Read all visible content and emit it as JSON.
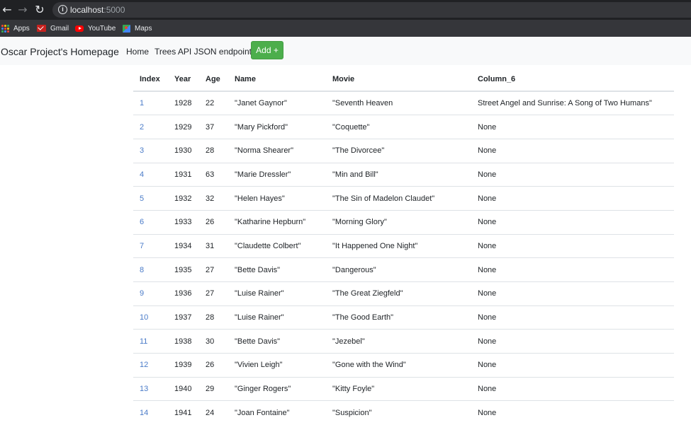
{
  "browser": {
    "url_host": "localhost",
    "url_port": ":5000",
    "bookmarks": [
      {
        "label": "Apps",
        "icon": "apps-grid-icon"
      },
      {
        "label": "Gmail",
        "icon": "gmail-icon"
      },
      {
        "label": "YouTube",
        "icon": "youtube-icon"
      },
      {
        "label": "Maps",
        "icon": "maps-icon"
      }
    ]
  },
  "navbar": {
    "brand": "Oscar Project's Homepage",
    "links": [
      "Home",
      "Trees API JSON endpoint"
    ],
    "add_button": "Add +"
  },
  "colors": {
    "accent_link": "#4a7bc8",
    "add_button": "#4cae4c",
    "navbar_bg": "#f8f9fa"
  },
  "table": {
    "columns": [
      "Index",
      "Year",
      "Age",
      "Name",
      "Movie",
      "Column_6"
    ],
    "rows": [
      [
        "1",
        "1928",
        "22",
        "\"Janet Gaynor\"",
        "\"Seventh Heaven",
        "Street Angel and Sunrise: A Song of Two Humans\""
      ],
      [
        "2",
        "1929",
        "37",
        "\"Mary Pickford\"",
        "\"Coquette\"",
        "None"
      ],
      [
        "3",
        "1930",
        "28",
        "\"Norma Shearer\"",
        "\"The Divorcee\"",
        "None"
      ],
      [
        "4",
        "1931",
        "63",
        "\"Marie Dressler\"",
        "\"Min and Bill\"",
        "None"
      ],
      [
        "5",
        "1932",
        "32",
        "\"Helen Hayes\"",
        "\"The Sin of Madelon Claudet\"",
        "None"
      ],
      [
        "6",
        "1933",
        "26",
        "\"Katharine Hepburn\"",
        "\"Morning Glory\"",
        "None"
      ],
      [
        "7",
        "1934",
        "31",
        "\"Claudette Colbert\"",
        "\"It Happened One Night\"",
        "None"
      ],
      [
        "8",
        "1935",
        "27",
        "\"Bette Davis\"",
        "\"Dangerous\"",
        "None"
      ],
      [
        "9",
        "1936",
        "27",
        "\"Luise Rainer\"",
        "\"The Great Ziegfeld\"",
        "None"
      ],
      [
        "10",
        "1937",
        "28",
        "\"Luise Rainer\"",
        "\"The Good Earth\"",
        "None"
      ],
      [
        "11",
        "1938",
        "30",
        "\"Bette Davis\"",
        "\"Jezebel\"",
        "None"
      ],
      [
        "12",
        "1939",
        "26",
        "\"Vivien Leigh\"",
        "\"Gone with the Wind\"",
        "None"
      ],
      [
        "13",
        "1940",
        "29",
        "\"Ginger Rogers\"",
        "\"Kitty Foyle\"",
        "None"
      ],
      [
        "14",
        "1941",
        "24",
        "\"Joan Fontaine\"",
        "\"Suspicion\"",
        "None"
      ]
    ]
  }
}
